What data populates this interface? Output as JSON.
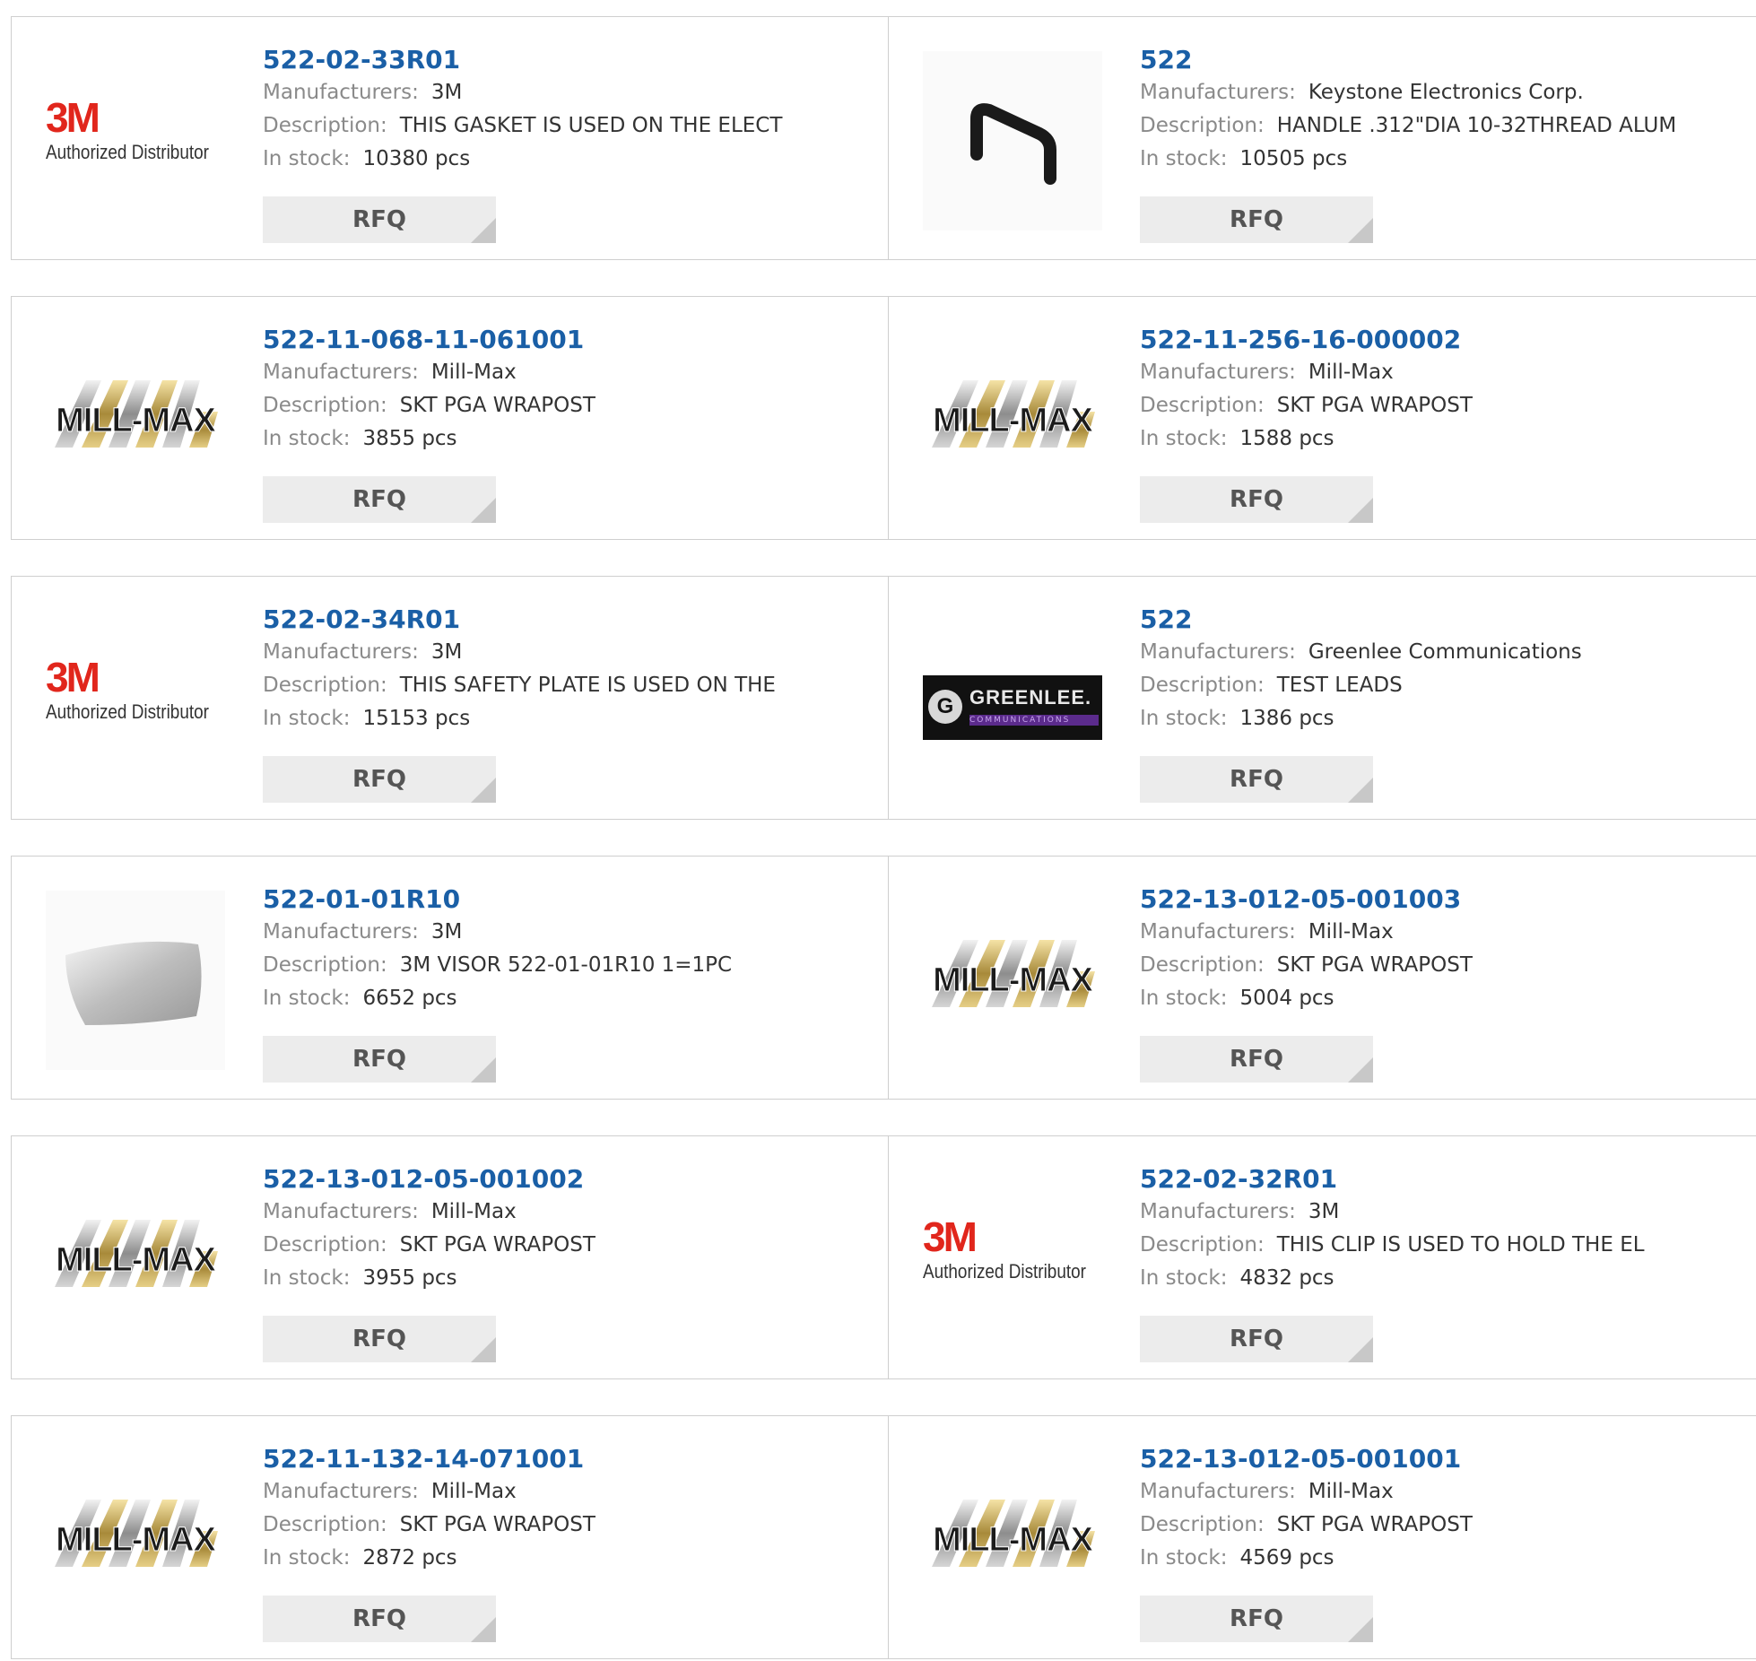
{
  "labels": {
    "manufacturers": "Manufacturers:",
    "description": "Description:",
    "stock": "In stock:",
    "rfq": "RFQ"
  },
  "logo_text": {
    "m3": "3M",
    "authorized": "Authorized Distributor",
    "millmax": "MILL-MAX",
    "greenlee": "GREENLEE.",
    "greenlee_sub": "COMMUNICATIONS"
  },
  "colors": {
    "link": "#1a5fa6",
    "label": "#8a8a8a",
    "brand_3m": "#e1261c",
    "rfq_bg": "#ececec"
  },
  "products": [
    {
      "part": "522-02-33R01",
      "manufacturer": "3M",
      "description": "THIS GASKET IS USED ON THE ELECT",
      "stock": "10380 pcs",
      "logo": "3m"
    },
    {
      "part": "522",
      "manufacturer": "Keystone Electronics Corp.",
      "description": "HANDLE .312\"DIA 10-32THREAD ALUM",
      "stock": "10505 pcs",
      "logo": "handle"
    },
    {
      "part": "522-11-068-11-061001",
      "manufacturer": "Mill-Max",
      "description": "SKT PGA WRAPOST",
      "stock": "3855 pcs",
      "logo": "millmax"
    },
    {
      "part": "522-11-256-16-000002",
      "manufacturer": "Mill-Max",
      "description": "SKT PGA WRAPOST",
      "stock": "1588 pcs",
      "logo": "millmax"
    },
    {
      "part": "522-02-34R01",
      "manufacturer": "3M",
      "description": "THIS SAFETY PLATE IS USED ON THE",
      "stock": "15153 pcs",
      "logo": "3m"
    },
    {
      "part": "522",
      "manufacturer": "Greenlee Communications",
      "description": "TEST LEADS",
      "stock": "1386 pcs",
      "logo": "greenlee"
    },
    {
      "part": "522-01-01R10",
      "manufacturer": "3M",
      "description": "3M VISOR 522-01-01R10 1=1PC",
      "stock": "6652 pcs",
      "logo": "visor"
    },
    {
      "part": "522-13-012-05-001003",
      "manufacturer": "Mill-Max",
      "description": "SKT PGA WRAPOST",
      "stock": "5004 pcs",
      "logo": "millmax"
    },
    {
      "part": "522-13-012-05-001002",
      "manufacturer": "Mill-Max",
      "description": "SKT PGA WRAPOST",
      "stock": "3955 pcs",
      "logo": "millmax"
    },
    {
      "part": "522-02-32R01",
      "manufacturer": "3M",
      "description": "THIS CLIP IS USED TO HOLD THE EL",
      "stock": "4832 pcs",
      "logo": "3m"
    },
    {
      "part": "522-11-132-14-071001",
      "manufacturer": "Mill-Max",
      "description": "SKT PGA WRAPOST",
      "stock": "2872 pcs",
      "logo": "millmax"
    },
    {
      "part": "522-13-012-05-001001",
      "manufacturer": "Mill-Max",
      "description": "SKT PGA WRAPOST",
      "stock": "4569 pcs",
      "logo": "millmax"
    }
  ]
}
